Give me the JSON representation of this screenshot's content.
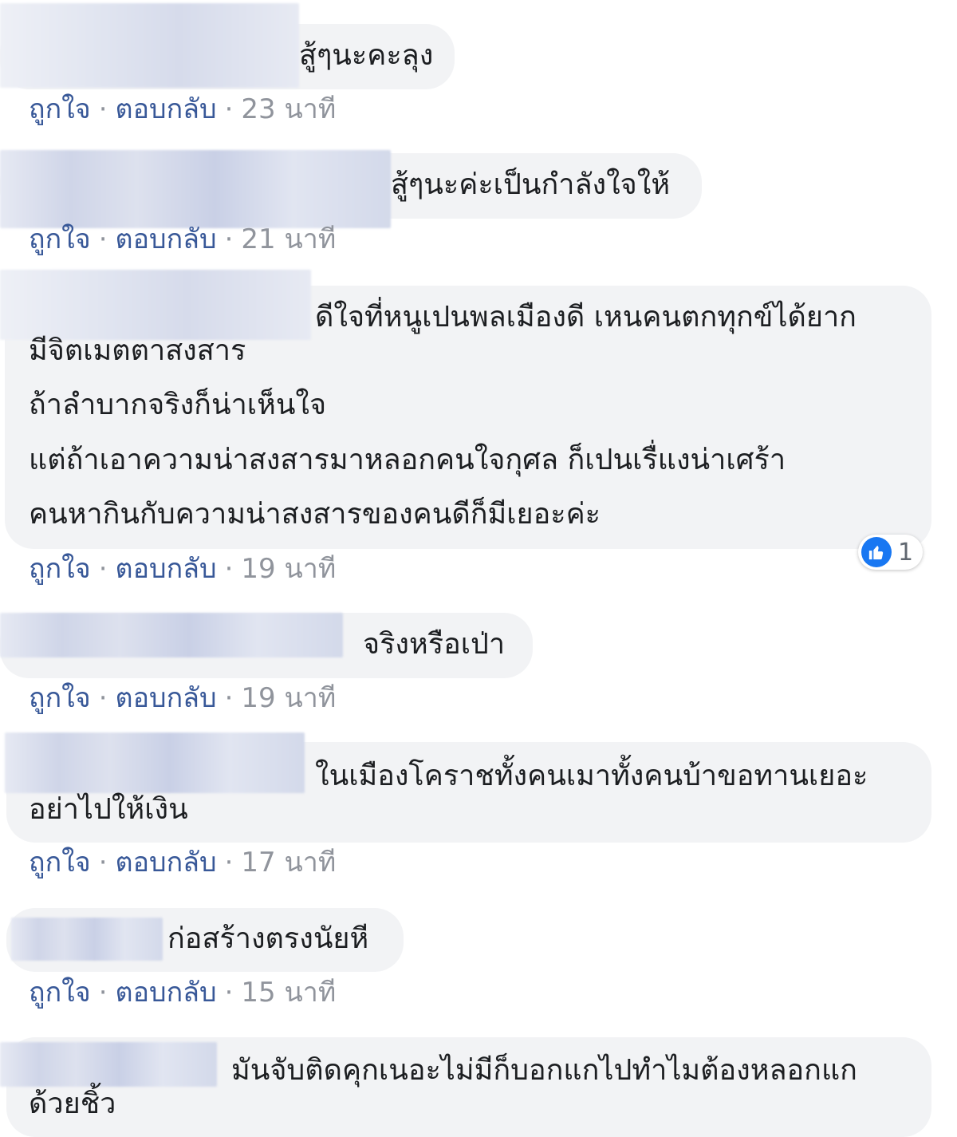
{
  "actions": {
    "like": "ถูกใจ",
    "reply": "ตอบกลับ",
    "separator": "·"
  },
  "comments": [
    {
      "text": "สู้ๆนะคะลุง",
      "time": "23 นาที"
    },
    {
      "text": "สู้ๆนะค่ะเป็นกำลังใจให้",
      "time": "21 นาที"
    },
    {
      "lines": [
        "ดีใจที่หนูเปนพลเมืองดี เหนคนตกทุกข์ได้ยาก",
        "มีจิตเมตตาสงสาร",
        "ถ้าลำบากจริงก็น่าเห็นใจ",
        "แต่ถ้าเอาความน่าสงสารมาหลอกคนใจกุศล ก็เปนเรื่แงน่าเศร้า",
        "คนหากินกับความน่าสงสารของคนดีก็มีเยอะค่ะ"
      ],
      "time": "19 นาที",
      "reaction_count": "1"
    },
    {
      "text": "จริงหรือเป่า",
      "time": "19 นาที"
    },
    {
      "lines": [
        "ในเมืองโคราชทั้งคนเมาทั้งคนบ้าขอทานเยอะ",
        "อย่าไปให้เงิน"
      ],
      "time": "17 นาที"
    },
    {
      "text": "ก่อสร้างตรงนัยหี",
      "time": "15 นาที"
    },
    {
      "lines": [
        "มันจับติดคุกเนอะไม่มีก็บอกแกไปทำไมต้องหลอกแก",
        "ด้วยชิ้ว"
      ]
    }
  ]
}
